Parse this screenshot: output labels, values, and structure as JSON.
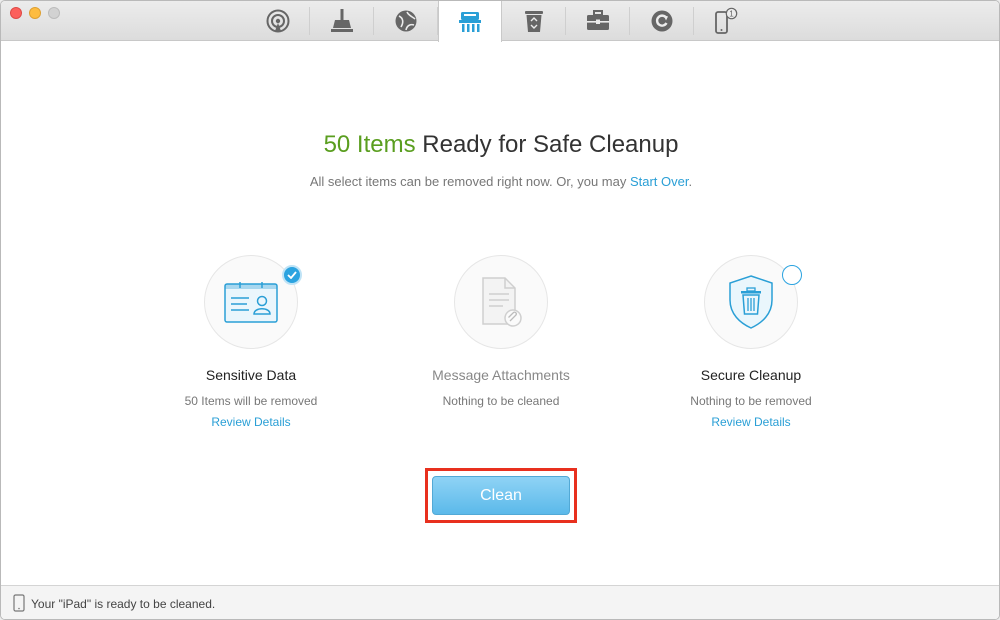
{
  "window": {
    "toolbar": {
      "tools": [
        {
          "icon": "airdrop-icon",
          "active": false
        },
        {
          "icon": "broom-icon",
          "active": false
        },
        {
          "icon": "globe-icon",
          "active": false
        },
        {
          "icon": "shredder-icon",
          "active": true
        },
        {
          "icon": "trash-icon",
          "active": false
        },
        {
          "icon": "toolbox-icon",
          "active": false
        },
        {
          "icon": "refresh-icon",
          "active": false
        },
        {
          "icon": "iphone-icon",
          "active": false,
          "badge": "1"
        }
      ]
    }
  },
  "main": {
    "headline_count": "50 Items",
    "headline_rest": " Ready for Safe Cleanup",
    "subline_text": "All select items can be removed right now. Or, you may ",
    "subline_link": "Start Over",
    "subline_end": "."
  },
  "cards": [
    {
      "title": "Sensitive Data",
      "desc": "50 Items will be removed",
      "link": "Review Details",
      "checked": true,
      "icon": "contact-card-icon"
    },
    {
      "title": "Message Attachments",
      "desc": "Nothing to be cleaned",
      "link": "",
      "checked": null,
      "icon": "attachment-document-icon"
    },
    {
      "title": "Secure Cleanup",
      "desc": "Nothing to be removed",
      "link": "Review Details",
      "checked": false,
      "icon": "shield-trash-icon"
    }
  ],
  "clean_button": {
    "label": "Clean"
  },
  "status": {
    "text": "Your \"iPad\" is ready to be cleaned."
  },
  "colors": {
    "accent": "#2a9fd6",
    "green": "#5a9e1f",
    "highlight": "#e8301e"
  }
}
